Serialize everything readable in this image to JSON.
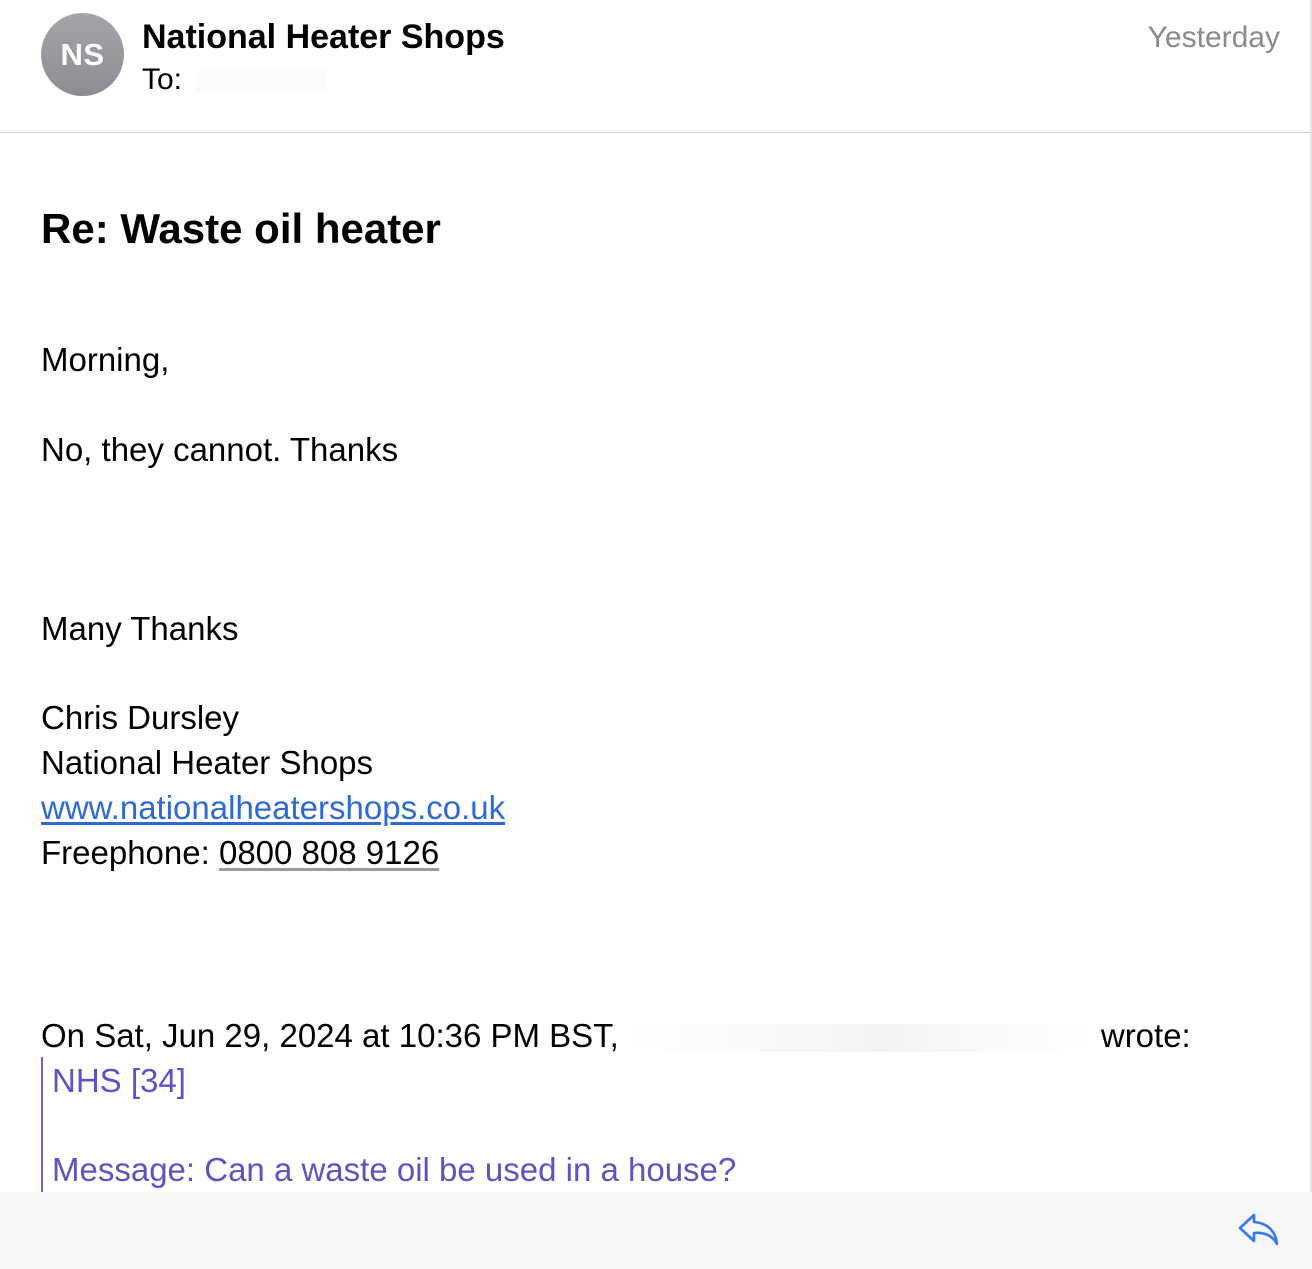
{
  "header": {
    "avatar_initials": "NS",
    "sender": "National Heater Shops",
    "to_label": "To:",
    "date": "Yesterday"
  },
  "subject": "Re: Waste oil heater",
  "body": {
    "greeting": "Morning,",
    "message": "No, they cannot. Thanks",
    "signoff": "Many Thanks",
    "signature": {
      "name": "Chris Dursley",
      "company": "National Heater Shops",
      "website": "www.nationalheatershops.co.uk",
      "freephone_label": "Freephone:",
      "freephone_number": "0800 808 9126"
    }
  },
  "quoted": {
    "attribution_prefix": "On Sat, Jun 29, 2024 at 10:36 PM BST,",
    "attribution_suffix": "wrote:",
    "line1": "NHS [34]",
    "line2": "Message: Can a waste oil be used in a house?"
  },
  "toolbar": {
    "reply_icon": "reply-icon"
  },
  "colors": {
    "link": "#2d6ad6",
    "quote": "#5a54c4",
    "date": "#8a8a8e",
    "reply_icon": "#3478f6"
  }
}
